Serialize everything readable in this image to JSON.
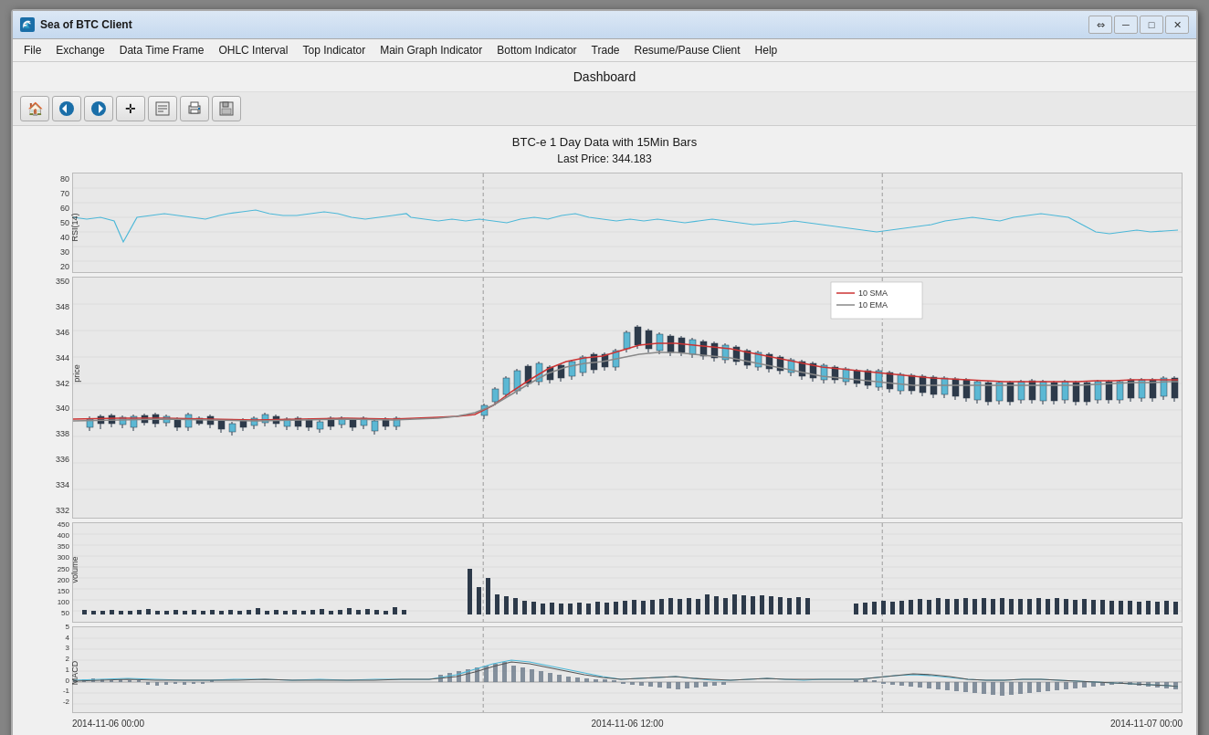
{
  "window": {
    "title": "Sea of BTC Client",
    "icon": "🌊"
  },
  "title_bar_controls": {
    "restore": "⇔",
    "minimize": "─",
    "maximize": "□",
    "close": "✕"
  },
  "menu": {
    "items": [
      "File",
      "Exchange",
      "Data Time Frame",
      "OHLC Interval",
      "Top Indicator",
      "Main Graph Indicator",
      "Bottom Indicator",
      "Trade",
      "Resume/Pause Client",
      "Help"
    ]
  },
  "dashboard": {
    "title": "Dashboard"
  },
  "toolbar": {
    "buttons": [
      {
        "name": "home",
        "icon": "🏠"
      },
      {
        "name": "back",
        "icon": "↩"
      },
      {
        "name": "forward",
        "icon": "↪"
      },
      {
        "name": "crosshair",
        "icon": "✛"
      },
      {
        "name": "edit",
        "icon": "✎"
      },
      {
        "name": "print",
        "icon": "🖨"
      },
      {
        "name": "save",
        "icon": "💾"
      }
    ]
  },
  "chart": {
    "title": "BTC-e 1 Day Data with 15Min Bars",
    "subtitle": "Last Price: 344.183",
    "legend": {
      "items": [
        {
          "label": "10 SMA",
          "color": "#cc3333"
        },
        {
          "label": "10 EMA",
          "color": "#888888"
        }
      ]
    },
    "rsi": {
      "label": "RSI(14)",
      "y_ticks": [
        "80",
        "70",
        "60",
        "50",
        "40",
        "30",
        "20"
      ]
    },
    "price": {
      "label": "price",
      "y_ticks": [
        "350",
        "348",
        "346",
        "344",
        "342",
        "340",
        "338",
        "336",
        "334",
        "332"
      ]
    },
    "volume": {
      "label": "volume",
      "y_ticks": [
        "450",
        "400",
        "350",
        "300",
        "250",
        "200",
        "150",
        "100",
        "50"
      ]
    },
    "macd": {
      "label": "MACD",
      "y_ticks": [
        "5",
        "4",
        "3",
        "2",
        "1",
        "0",
        "-1",
        "-2"
      ]
    },
    "x_axis": {
      "ticks": [
        "2014-11-06 00:00",
        "2014-11-06 12:00",
        "2014-11-07 00:00"
      ]
    }
  }
}
